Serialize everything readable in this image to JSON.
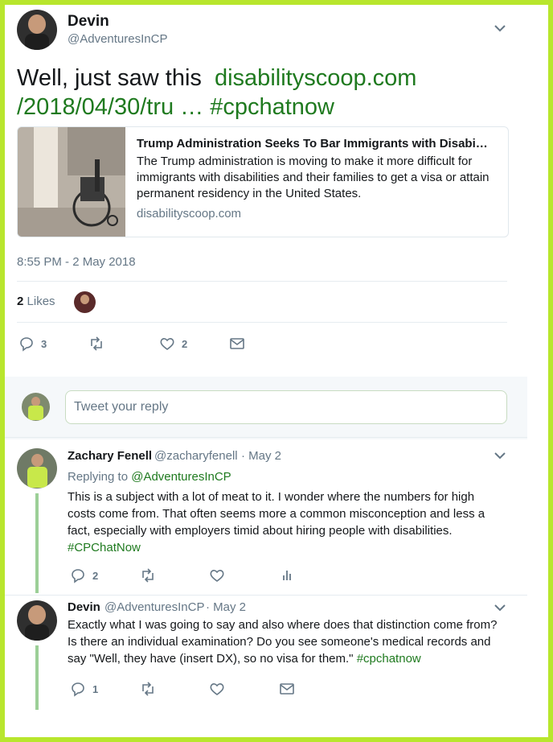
{
  "main_tweet": {
    "author_name": "Devin",
    "author_handle": "@AdventuresInCP",
    "text_prefix": "Well, just saw this",
    "link_line1": "disabilityscoop.com",
    "link_line2": "/2018/04/30/tru",
    "ellipsis": " … ",
    "hashtag": "#cpchatnow",
    "card": {
      "title": "Trump Administration Seeks To Bar Immigrants with Disabi…",
      "description": "The Trump administration is moving to make it more difficult for immigrants with disabilities and their families to get a visa or attain permanent residency in the United States.",
      "domain": "disabilityscoop.com"
    },
    "timestamp": "8:55 PM - 2 May 2018",
    "likes_count": "2",
    "likes_label": "Likes",
    "actions": {
      "reply_count": "3",
      "like_count": "2"
    }
  },
  "reply_box": {
    "placeholder": "Tweet your reply"
  },
  "replies": [
    {
      "author_name": "Zachary Fenell",
      "author_handle": "@zacharyfenell",
      "date": "· May 2",
      "replying_label": "Replying to",
      "replying_handle": "@AdventuresInCP",
      "text": "This is a subject with a lot of meat to it. I wonder where the numbers for high costs come from. That often seems more a common misconception and less a fact, especially with employers timid about hiring people with disabilities.",
      "hashtag": "#CPChatNow",
      "reply_count": "2"
    },
    {
      "author_name": "Devin",
      "author_handle": "@AdventuresInCP",
      "date": "· May 2",
      "text": "Exactly what I was going to say and also where does that distinction come from? Is there an individual examination? Do you see someone's medical records and say \"Well, they have (insert DX), so no visa for them.\"",
      "hashtag": "#cpchatnow",
      "reply_count": "1"
    }
  ],
  "icons": [
    "reply-icon",
    "retweet-icon",
    "heart-icon",
    "mail-icon",
    "bar-chart-icon",
    "chevron-down-icon"
  ],
  "colors": {
    "border_frame": "#b8e62d",
    "link_green": "#1f7a1f",
    "thread_line": "#9ccf97",
    "muted": "#657786"
  }
}
